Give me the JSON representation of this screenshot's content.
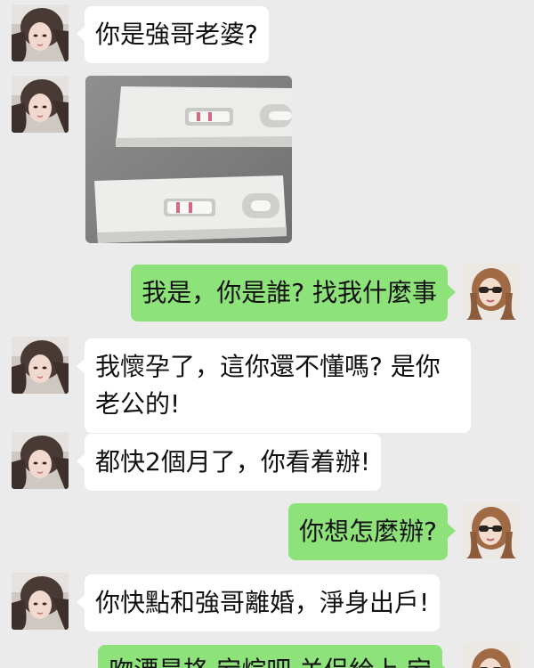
{
  "messages": [
    {
      "side": "left",
      "type": "text",
      "text": "你是強哥老婆?"
    },
    {
      "side": "left",
      "type": "image",
      "image": "pregnancy-test-photo"
    },
    {
      "side": "right",
      "type": "text",
      "text": "我是，你是誰? 找我什麼事"
    },
    {
      "side": "left",
      "type": "text",
      "text": "我懷孕了，這你還不懂嗎? 是你老公的!"
    },
    {
      "side": "left",
      "type": "text",
      "text": "都快2個月了，你看着辦!"
    },
    {
      "side": "right",
      "type": "text",
      "text": "你想怎麼辦?"
    },
    {
      "side": "left",
      "type": "text",
      "text": "你快點和強哥離婚，淨身出戶!"
    },
    {
      "side": "right",
      "type": "text",
      "text": "吻漂是挌 宕烷吧 关侣給上 宕"
    }
  ],
  "colors": {
    "background": "#ebebeb",
    "incoming_bubble": "#ffffff",
    "outgoing_bubble": "#8ee27a",
    "test_line": "#d26a82"
  },
  "icons": {
    "left_avatar": "girl-avatar-icon",
    "right_avatar": "sunglasses-girl-avatar-icon"
  }
}
